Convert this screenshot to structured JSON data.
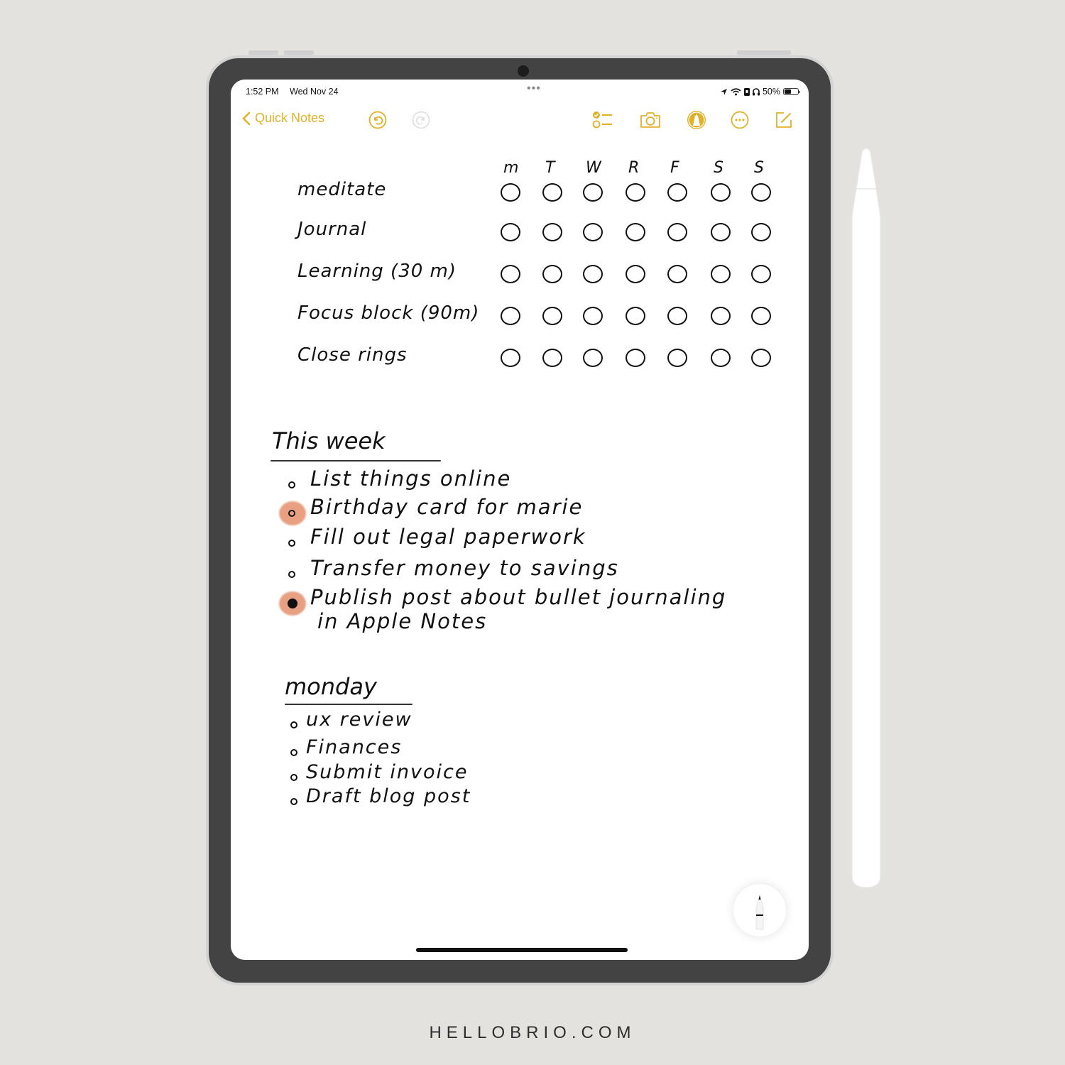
{
  "status_bar": {
    "time": "1:52 PM",
    "date": "Wed Nov 24",
    "battery": "50%",
    "battery_level": 0.5,
    "multitask_dots": "•••"
  },
  "toolbar": {
    "back_label": "Quick Notes",
    "accent_color": "#e0b129",
    "icons": [
      "undo-icon",
      "redo-icon",
      "checklist-icon",
      "camera-icon",
      "markup-icon",
      "more-icon",
      "compose-icon"
    ]
  },
  "habit_tracker": {
    "days": [
      "m",
      "T",
      "W",
      "R",
      "F",
      "S",
      "S"
    ],
    "habits": [
      {
        "label": "meditate",
        "checked": [
          false,
          false,
          false,
          false,
          false,
          false,
          false
        ]
      },
      {
        "label": "Journal",
        "checked": [
          false,
          false,
          false,
          false,
          false,
          false,
          false
        ]
      },
      {
        "label": "Learning (30 m)",
        "checked": [
          false,
          false,
          false,
          false,
          false,
          false,
          false
        ]
      },
      {
        "label": "Focus block (90m)",
        "checked": [
          false,
          false,
          false,
          false,
          false,
          false,
          false
        ]
      },
      {
        "label": "Close rings",
        "checked": [
          false,
          false,
          false,
          false,
          false,
          false,
          false
        ]
      }
    ]
  },
  "this_week": {
    "title": "This week",
    "highlight_color": "#e3906d",
    "items": [
      {
        "text": "List things online",
        "highlighted": false,
        "filled": false
      },
      {
        "text": "Birthday card for marie",
        "highlighted": true,
        "filled": false
      },
      {
        "text": "Fill out legal paperwork",
        "highlighted": false,
        "filled": false
      },
      {
        "text": "Transfer money to savings",
        "highlighted": false,
        "filled": false
      },
      {
        "text": "Publish post about bullet journaling",
        "text2": "in Apple Notes",
        "highlighted": true,
        "filled": true
      }
    ]
  },
  "monday": {
    "title": "monday",
    "items": [
      "ux review",
      "Finances",
      "Submit invoice",
      "Draft blog post"
    ]
  },
  "footer": {
    "brand": "HELLOBRIO.COM"
  }
}
